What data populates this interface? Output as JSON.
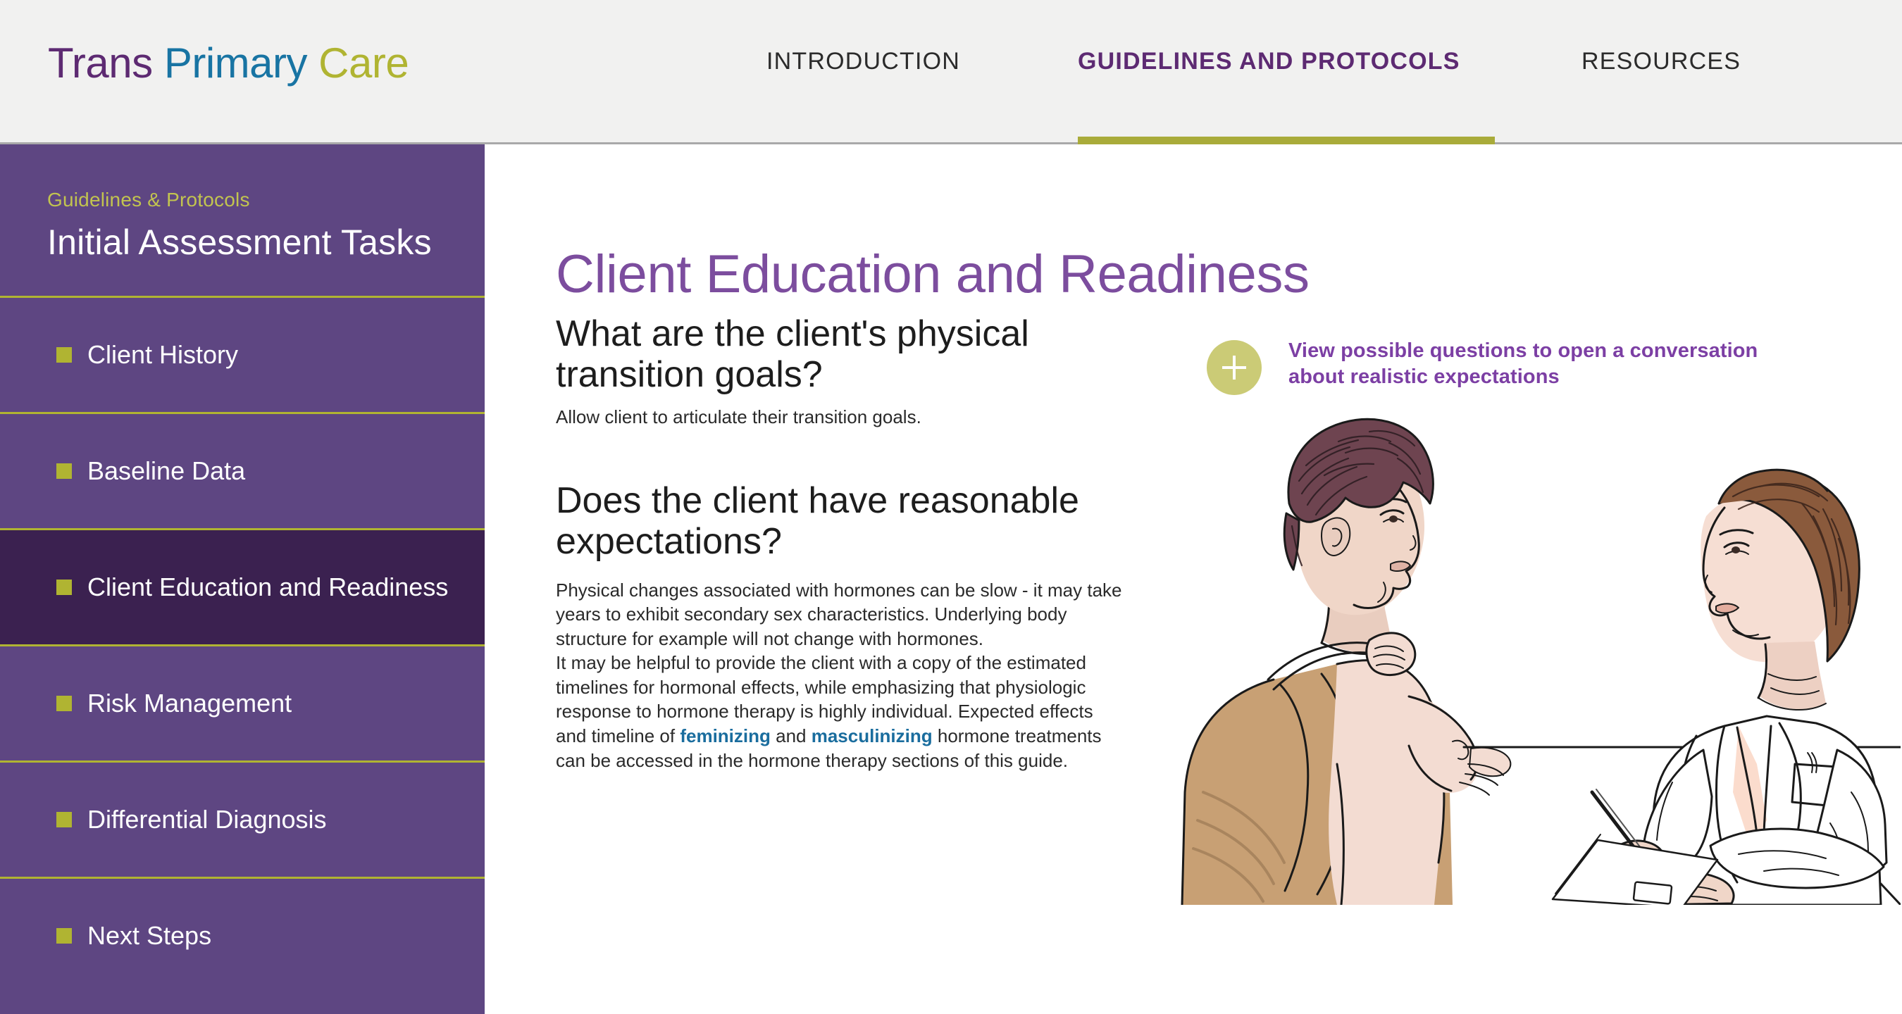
{
  "header": {
    "logo": {
      "word1": "Trans",
      "word2": "Primary",
      "word3": "Care"
    },
    "nav": [
      {
        "label": "INTRODUCTION",
        "active": false
      },
      {
        "label": "GUIDELINES AND PROTOCOLS",
        "active": true
      },
      {
        "label": "RESOURCES",
        "active": false
      }
    ]
  },
  "sidebar": {
    "eyebrow": "Guidelines & Protocols",
    "title": "Initial Assessment Tasks",
    "items": [
      {
        "label": "Client History",
        "active": false
      },
      {
        "label": "Baseline Data",
        "active": false
      },
      {
        "label": "Client Education and Readiness",
        "active": true
      },
      {
        "label": "Risk Management",
        "active": false
      },
      {
        "label": "Differential Diagnosis",
        "active": false
      },
      {
        "label": "Next Steps",
        "active": false
      }
    ]
  },
  "main": {
    "page_title": "Client Education and Readiness",
    "section1": {
      "heading": "What are the client's physical transition goals?",
      "body": "Allow client to articulate their transition goals."
    },
    "section2": {
      "heading": "Does the client have reasonable expectations?",
      "body_part1": "Physical changes associated with hormones can be slow - it may take years to exhibit secondary sex characteristics. Underlying body structure for example will not change with hormones.",
      "body_part2": "It may be helpful to provide the client with a copy of the estimated timelines for hormonal effects, while emphasizing that physiologic response to hormone therapy is highly individual. Expected effects and timeline of ",
      "link1": "feminizing",
      "body_mid": " and ",
      "link2": "masculinizing",
      "body_part3": " hormone treatments can be accessed in the hormone therapy sections of this guide."
    },
    "callout": {
      "icon": "plus-icon",
      "text": "View possible questions to open a conversation about realistic expectations"
    },
    "illustration": {
      "alt": "Illustration of a client in a tan shirt seated across from a clinician in a white coat writing on a clipboard at a desk"
    }
  },
  "colors": {
    "brand_purple": "#5d2a72",
    "brand_blue": "#1874a3",
    "brand_olive": "#b0b432",
    "sidebar_purple": "#5e4682",
    "sidebar_active": "#3b2150",
    "title_purple": "#7c4d9e",
    "link_blue": "#1a6d9e",
    "callout_circle": "#cbcb76",
    "header_bg": "#f1f1f0"
  }
}
